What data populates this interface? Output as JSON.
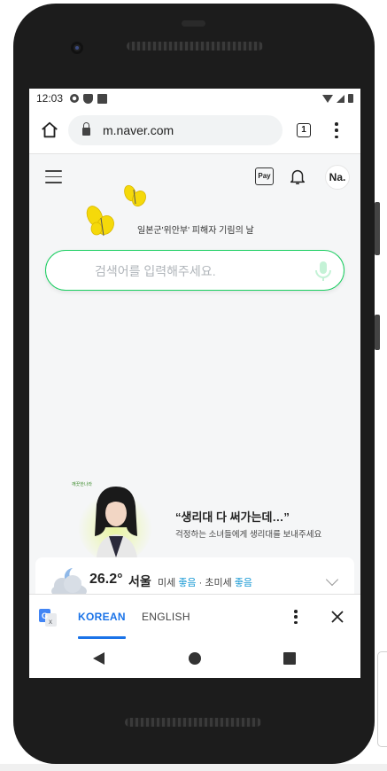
{
  "statusbar": {
    "time": "12:03",
    "icons": [
      "gear-icon",
      "shield-icon",
      "sim-card-icon",
      "wifi-icon",
      "signal-icon",
      "battery-icon"
    ]
  },
  "browser": {
    "url": "m.naver.com",
    "tab_count": "1",
    "icons": [
      "home-icon",
      "lock-icon",
      "more-vert-icon"
    ]
  },
  "naver": {
    "pay_label": "Pay",
    "avatar_label": "Na.",
    "doodle_caption": "일본군'위안부' 피해자 기림의 날",
    "search": {
      "placeholder": "검색어를 입력해주세요.",
      "value": ""
    },
    "ad": {
      "logo_text": "깨끗한나라",
      "headline": "“생리대 다 써가는데…”",
      "subtext": "걱정하는 소녀들에게 생리대를 보내주세요"
    },
    "weather": {
      "temperature": "26.2°",
      "city": "서울",
      "fine_dust_label": "미세",
      "fine_dust_value": "좋음",
      "separator": "·",
      "ultrafine_dust_label": "초미세",
      "ultrafine_dust_value": "좋음"
    }
  },
  "translate": {
    "languages": [
      "KOREAN",
      "ENGLISH"
    ],
    "active": "KOREAN"
  },
  "colors": {
    "naver_green": "#19ce60",
    "translate_blue": "#1a73e8",
    "dust_good": "#1c9bd5",
    "butterfly_yellow": "#f5d90a"
  }
}
